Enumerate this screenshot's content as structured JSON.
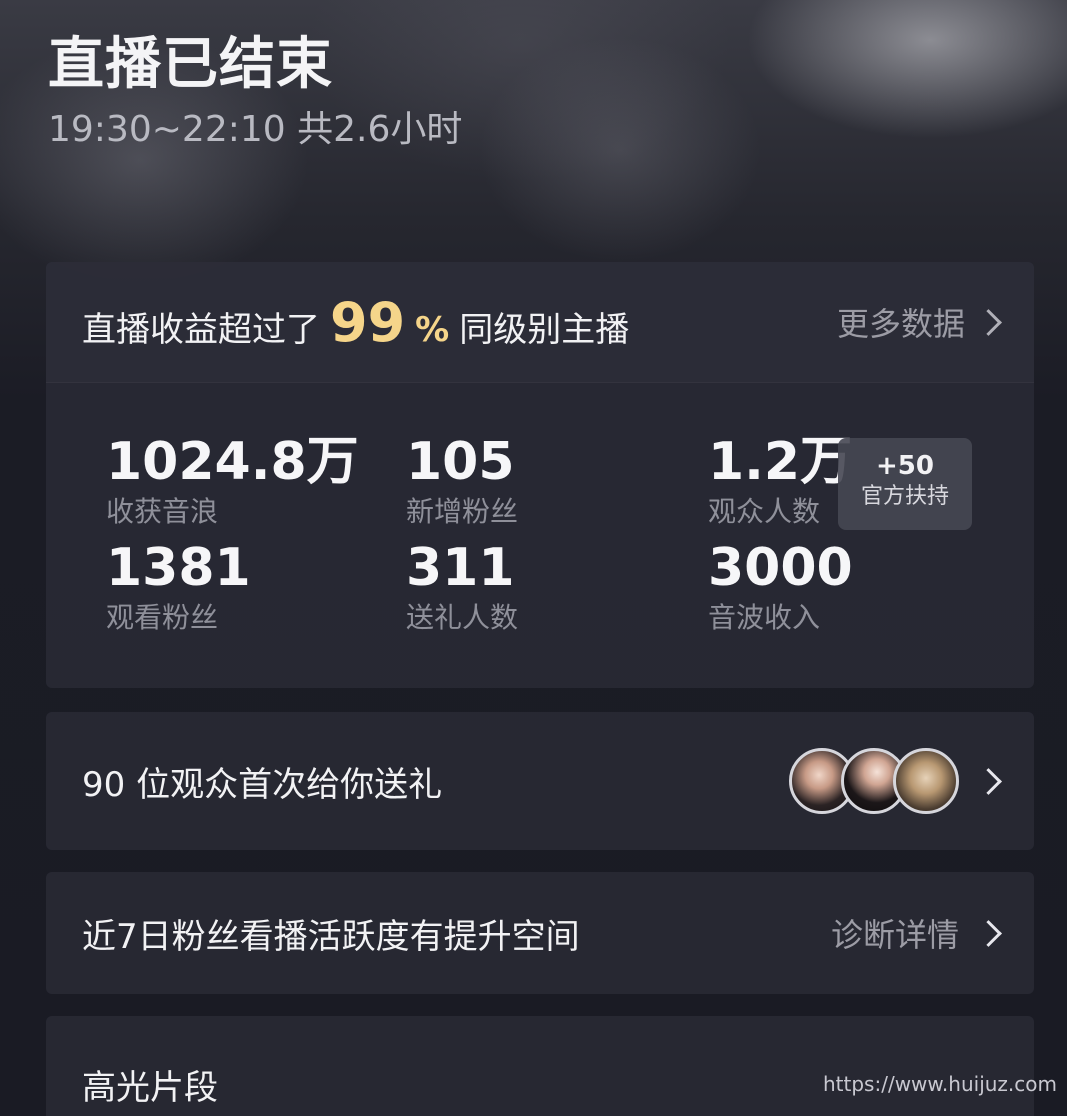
{
  "header": {
    "title": "直播已结束",
    "subtitle": "19:30~22:10 共2.6小时"
  },
  "summary": {
    "banner_prefix": "直播收益超过了",
    "banner_percent": "99",
    "banner_percent_sign": "%",
    "banner_suffix": "同级别主播",
    "more_label": "更多数据",
    "stats": [
      {
        "value": "1024.8万",
        "label": "收获音浪"
      },
      {
        "value": "105",
        "label": "新增粉丝"
      },
      {
        "value": "1.2万",
        "label": "观众人数"
      },
      {
        "value": "1381",
        "label": "观看粉丝"
      },
      {
        "value": "311",
        "label": "送礼人数"
      },
      {
        "value": "3000",
        "label": "音波收入"
      }
    ],
    "support_badge": {
      "value": "+50",
      "label": "官方扶持"
    }
  },
  "gift_row": {
    "text": "90 位观众首次给你送礼"
  },
  "active_row": {
    "text": "近7日粉丝看播活跃度有提升空间",
    "link_label": "诊断详情"
  },
  "highlight": {
    "title": "高光片段"
  },
  "watermark": "https://www.huijuz.com",
  "colors": {
    "accent_gold": "#f5d58a",
    "card_bg": "#282934",
    "page_bg": "#1a1b24"
  }
}
